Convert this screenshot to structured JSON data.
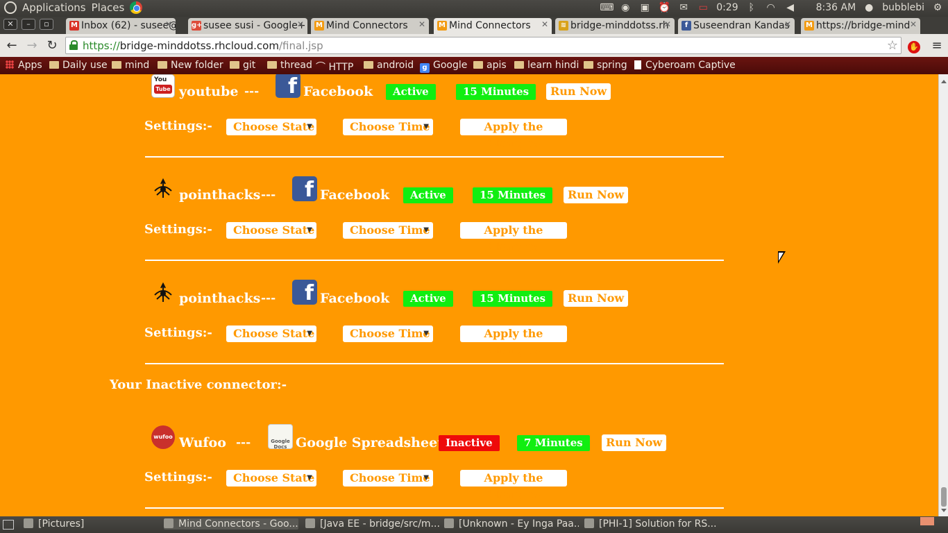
{
  "system_panel": {
    "menu_applications": "Applications",
    "menu_places": "Places",
    "battery": "0:29",
    "clock": "8:36 AM",
    "user": "bubblebi"
  },
  "browser": {
    "tabs": [
      {
        "label": "Inbox (62) - susee@",
        "favicon": "gmail-icon",
        "color": "#d93025"
      },
      {
        "label": "susee susi - Google+",
        "favicon": "googleplus-icon",
        "color": "#dd4b39"
      },
      {
        "label": "Mind Connectors",
        "favicon": "mindconnectors-icon",
        "color": "#f29b12"
      },
      {
        "label": "Mind Connectors",
        "favicon": "mindconnectors-icon",
        "color": "#f29b12"
      },
      {
        "label": "bridge-minddotss.rh",
        "favicon": "openshift-icon",
        "color": "#d9a21b"
      },
      {
        "label": "Suseendran Kandas",
        "favicon": "facebook-icon",
        "color": "#3b5998"
      },
      {
        "label": "https://bridge-mind",
        "favicon": "mindconnectors-icon",
        "color": "#f29b12"
      }
    ],
    "url_scheme": "https://",
    "url_host": "bridge-minddotss.rhcloud.com",
    "url_path": "/final.jsp",
    "bookmarks": [
      {
        "label": "Apps",
        "icon": "apps-icon"
      },
      {
        "label": "Daily use",
        "icon": "folder-icon"
      },
      {
        "label": "mind",
        "icon": "folder-icon"
      },
      {
        "label": "New folder",
        "icon": "folder-icon"
      },
      {
        "label": "git",
        "icon": "folder-icon"
      },
      {
        "label": "thread",
        "icon": "folder-icon"
      },
      {
        "label": "HTTP",
        "icon": "http-icon"
      },
      {
        "label": "android",
        "icon": "folder-icon"
      },
      {
        "label": "Google",
        "icon": "google-icon"
      },
      {
        "label": "apis",
        "icon": "folder-icon"
      },
      {
        "label": "learn hindi",
        "icon": "folder-icon"
      },
      {
        "label": "spring",
        "icon": "folder-icon"
      },
      {
        "label": "Cyberoam Captive",
        "icon": "page-icon"
      }
    ]
  },
  "page": {
    "active_connectors": [
      {
        "source": "youtube",
        "source_icon": "youtube-icon",
        "separator": "---",
        "target": "Facebook",
        "target_icon": "facebook-icon",
        "status": "Active",
        "interval": "15 Minutes",
        "run_label": "Run Now",
        "settings_label": "Settings:-",
        "state_placeholder": "Choose State",
        "time_placeholder": "Choose Time",
        "apply_label": "Apply the Changes"
      },
      {
        "source": "pointhacks",
        "source_icon": "pointhacks-icon",
        "separator": "---",
        "target": "Facebook",
        "target_icon": "facebook-icon",
        "status": "Active",
        "interval": "15 Minutes",
        "run_label": "Run Now",
        "settings_label": "Settings:-",
        "state_placeholder": "Choose State",
        "time_placeholder": "Choose Time",
        "apply_label": "Apply the Changes"
      },
      {
        "source": "pointhacks",
        "source_icon": "pointhacks-icon",
        "separator": "---",
        "target": "Facebook",
        "target_icon": "facebook-icon",
        "status": "Active",
        "interval": "15 Minutes",
        "run_label": "Run Now",
        "settings_label": "Settings:-",
        "state_placeholder": "Choose State",
        "time_placeholder": "Choose Time",
        "apply_label": "Apply the Changes"
      }
    ],
    "inactive_heading": "Your Inactive connector:-",
    "inactive_connectors": [
      {
        "source": "Wufoo",
        "source_icon": "wufoo-icon",
        "separator": "---",
        "target": "Google Spreadsheet",
        "target_icon": "google-docs-icon",
        "status": "Inactive",
        "interval": "7 Minutes",
        "run_label": "Run Now",
        "settings_label": "Settings:-",
        "state_placeholder": "Choose State",
        "time_placeholder": "Choose Time",
        "apply_label": "Apply the Changes"
      }
    ],
    "colors": {
      "background": "#ff9900",
      "active_badge": "#11ee11",
      "inactive_badge": "#ee0a0a"
    }
  },
  "taskbar": {
    "items": [
      {
        "label": "[Pictures]"
      },
      {
        "label": "Mind Connectors - Goo..."
      },
      {
        "label": "[Java EE - bridge/src/m..."
      },
      {
        "label": "[Unknown - Ey Inga Paa..."
      },
      {
        "label": "[PHI-1] Solution for RS..."
      }
    ]
  }
}
